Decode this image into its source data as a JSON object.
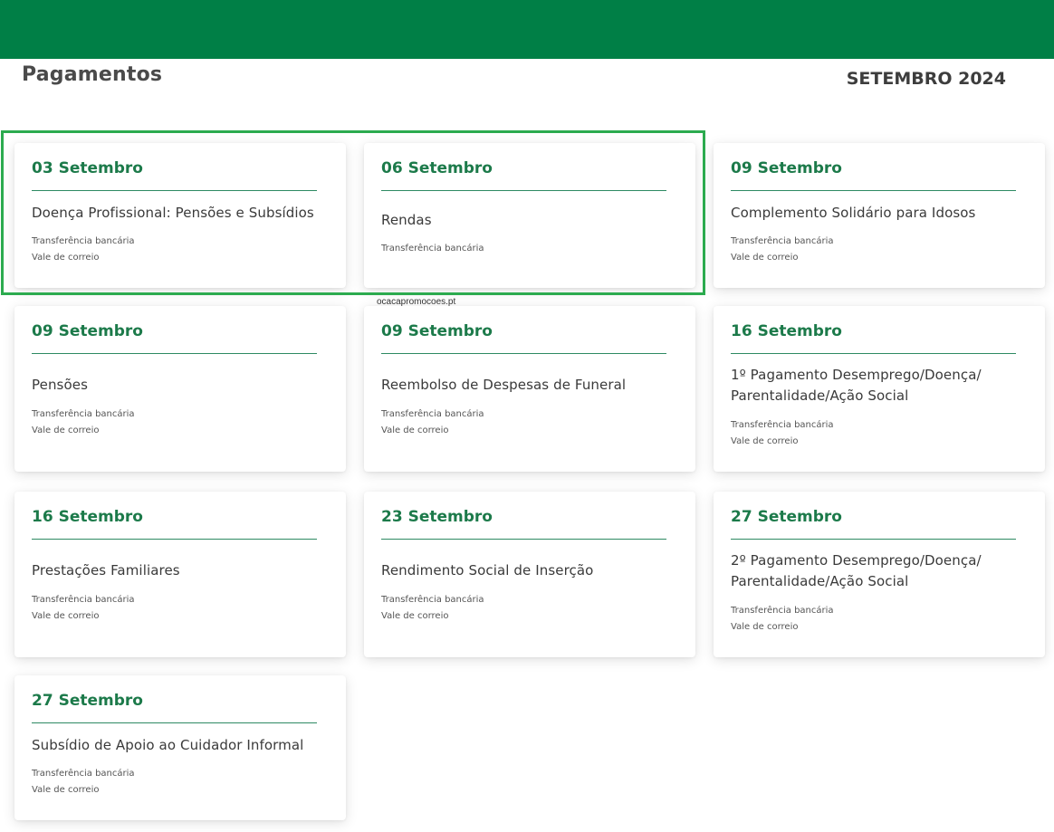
{
  "header": {
    "title": "Pagamentos",
    "month": "SETEMBRO 2024",
    "brand_color": "#007f46"
  },
  "watermark": "ocacapromocoes.pt",
  "accent_color": "#1c7a4a",
  "highlight_color": "#2cab4f",
  "cards": [
    {
      "date": "03 Setembro",
      "name": "Doença Profissional: Pensões e Subsídios",
      "methods": [
        "Transferência bancária",
        "Vale de correio"
      ]
    },
    {
      "date": "06 Setembro",
      "name": "Rendas",
      "methods": [
        "Transferência bancária"
      ]
    },
    {
      "date": "09 Setembro",
      "name": "Complemento Solidário para Idosos",
      "methods": [
        "Transferência bancária",
        "Vale de correio"
      ]
    },
    {
      "date": "09 Setembro",
      "name": "Pensões",
      "methods": [
        "Transferência bancária",
        "Vale de correio"
      ]
    },
    {
      "date": "09 Setembro",
      "name": "Reembolso de Despesas de Funeral",
      "methods": [
        "Transferência bancária",
        "Vale de correio"
      ]
    },
    {
      "date": "16 Setembro",
      "name": "1º Pagamento Desemprego/Doença/ Parentalidade/Ação Social",
      "methods": [
        "Transferência bancária",
        "Vale de correio"
      ]
    },
    {
      "date": "16 Setembro",
      "name": "Prestações Familiares",
      "methods": [
        "Transferência bancária",
        "Vale de correio"
      ]
    },
    {
      "date": "23 Setembro",
      "name": "Rendimento Social de Inserção",
      "methods": [
        "Transferência bancária",
        "Vale de correio"
      ]
    },
    {
      "date": "27 Setembro",
      "name": "2º Pagamento Desemprego/Doença/ Parentalidade/Ação Social",
      "methods": [
        "Transferência bancária",
        "Vale de correio"
      ]
    },
    {
      "date": "27 Setembro",
      "name": "Subsídio de Apoio ao Cuidador Informal",
      "methods": [
        "Transferência bancária",
        "Vale de correio"
      ]
    }
  ]
}
